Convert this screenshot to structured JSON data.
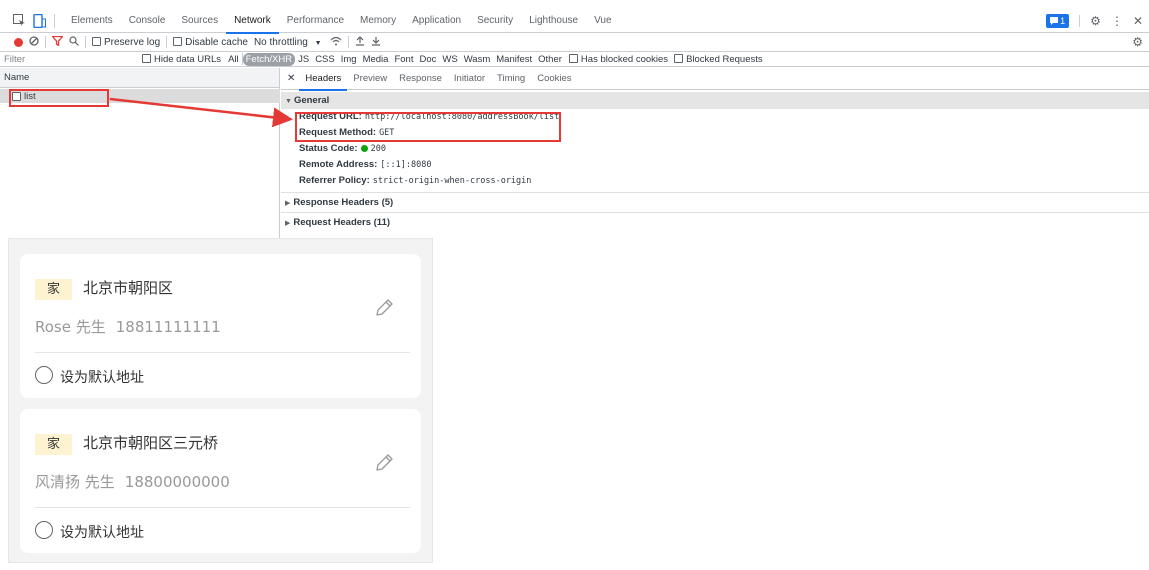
{
  "devtools": {
    "tabs": [
      "Elements",
      "Console",
      "Sources",
      "Network",
      "Performance",
      "Memory",
      "Application",
      "Security",
      "Lighthouse",
      "Vue"
    ],
    "active_tab": "Network",
    "issues_count": "1",
    "toolbar": {
      "preserve_log": "Preserve log",
      "disable_cache": "Disable cache",
      "throttling": "No throttling"
    },
    "filter": {
      "placeholder": "Filter",
      "hide_data_urls": "Hide data URLs",
      "types": [
        "All",
        "Fetch/XHR",
        "JS",
        "CSS",
        "Img",
        "Media",
        "Font",
        "Doc",
        "WS",
        "Wasm",
        "Manifest",
        "Other"
      ],
      "active_type": "Fetch/XHR",
      "has_blocked_cookies": "Has blocked cookies",
      "blocked_requests": "Blocked Requests"
    },
    "requests": {
      "name_header": "Name",
      "items": [
        "list"
      ]
    },
    "details": {
      "tabs": [
        "Headers",
        "Preview",
        "Response",
        "Initiator",
        "Timing",
        "Cookies"
      ],
      "active_tab": "Headers",
      "general_title": "General",
      "general": {
        "request_url_label": "Request URL:",
        "request_url": "http://localhost:8080/addressBook/list",
        "request_method_label": "Request Method:",
        "request_method": "GET",
        "status_code_label": "Status Code:",
        "status_code": "200",
        "remote_address_label": "Remote Address:",
        "remote_address": "[::1]:8080",
        "referrer_policy_label": "Referrer Policy:",
        "referrer_policy": "strict-origin-when-cross-origin"
      },
      "response_headers": "Response Headers (5)",
      "request_headers": "Request Headers (11)"
    }
  },
  "address_list": {
    "cards": [
      {
        "tag": "家",
        "address": "北京市朝阳区",
        "name": "Rose 先生",
        "phone": "18811111111",
        "default_label": "设为默认地址"
      },
      {
        "tag": "家",
        "address": "北京市朝阳区三元桥",
        "name": "风清扬 先生",
        "phone": "18800000000",
        "default_label": "设为默认地址"
      }
    ]
  },
  "colors": {
    "highlight": "#e53935",
    "accent": "#1a73e8",
    "status_ok": "#0ca30c",
    "tag_bg": "#fdf3d0"
  }
}
